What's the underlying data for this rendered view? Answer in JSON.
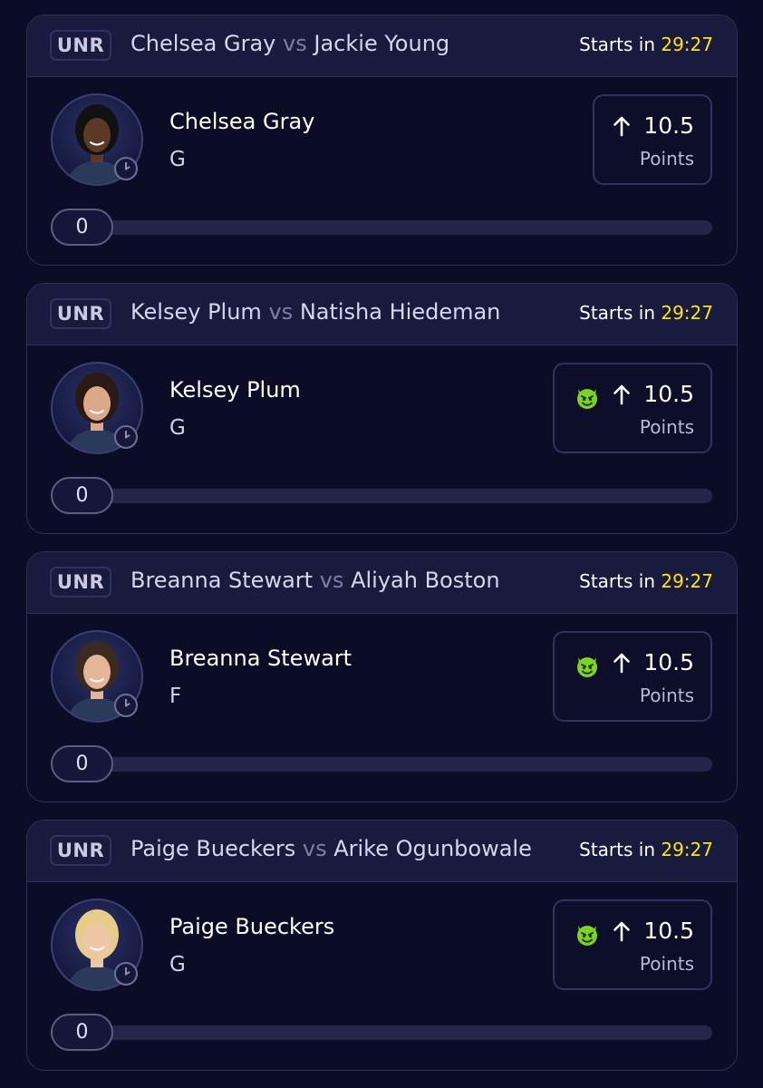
{
  "cards": [
    {
      "league": "UNR",
      "matchup": {
        "player_a": "Chelsea Gray",
        "vs": "vs",
        "player_b": "Jackie Young"
      },
      "starts_label": "Starts in",
      "countdown": "29:27",
      "player": {
        "name": "Chelsea Gray",
        "position": "G",
        "avatar_icon": "player-headshot"
      },
      "prop": {
        "direction_icon": "arrow-up-icon",
        "line": "10.5",
        "stat": "Points",
        "demon": false
      },
      "progress": {
        "value": "0",
        "fraction": 0
      }
    },
    {
      "league": "UNR",
      "matchup": {
        "player_a": "Kelsey Plum",
        "vs": "vs",
        "player_b": "Natisha Hiedeman"
      },
      "starts_label": "Starts in",
      "countdown": "29:27",
      "player": {
        "name": "Kelsey Plum",
        "position": "G",
        "avatar_icon": "player-headshot"
      },
      "prop": {
        "direction_icon": "arrow-up-icon",
        "line": "10.5",
        "stat": "Points",
        "demon": true
      },
      "progress": {
        "value": "0",
        "fraction": 0
      }
    },
    {
      "league": "UNR",
      "matchup": {
        "player_a": "Breanna Stewart",
        "vs": "vs",
        "player_b": "Aliyah Boston"
      },
      "starts_label": "Starts in",
      "countdown": "29:27",
      "player": {
        "name": "Breanna Stewart",
        "position": "F",
        "avatar_icon": "player-headshot"
      },
      "prop": {
        "direction_icon": "arrow-up-icon",
        "line": "10.5",
        "stat": "Points",
        "demon": true
      },
      "progress": {
        "value": "0",
        "fraction": 0
      }
    },
    {
      "league": "UNR",
      "matchup": {
        "player_a": "Paige Bueckers",
        "vs": "vs",
        "player_b": "Arike Ogunbowale"
      },
      "starts_label": "Starts in",
      "countdown": "29:27",
      "player": {
        "name": "Paige Bueckers",
        "position": "G",
        "avatar_icon": "player-headshot"
      },
      "prop": {
        "direction_icon": "arrow-up-icon",
        "line": "10.5",
        "stat": "Points",
        "demon": true
      },
      "progress": {
        "value": "0",
        "fraction": 0
      }
    }
  ],
  "colors": {
    "background": "#0b0c26",
    "card_header": "#181b3d",
    "countdown": "#ffe600",
    "demon": "#7ed321",
    "vs_text": "#7d80a6"
  },
  "avatar_skin_tones": [
    "#5a3a26",
    "#d9a98a",
    "#e4b697",
    "#efc7a6"
  ],
  "avatar_hair_tones": [
    "#111111",
    "#2a1a12",
    "#3a2a20",
    "#e8cc8a"
  ]
}
